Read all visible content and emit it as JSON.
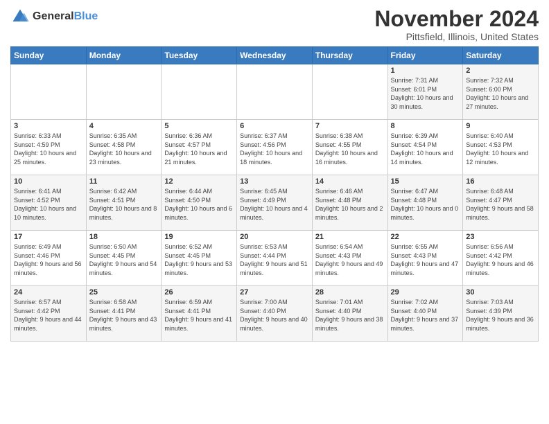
{
  "logo": {
    "general": "General",
    "blue": "Blue"
  },
  "title": "November 2024",
  "subtitle": "Pittsfield, Illinois, United States",
  "days_of_week": [
    "Sunday",
    "Monday",
    "Tuesday",
    "Wednesday",
    "Thursday",
    "Friday",
    "Saturday"
  ],
  "weeks": [
    [
      {
        "day": "",
        "info": ""
      },
      {
        "day": "",
        "info": ""
      },
      {
        "day": "",
        "info": ""
      },
      {
        "day": "",
        "info": ""
      },
      {
        "day": "",
        "info": ""
      },
      {
        "day": "1",
        "info": "Sunrise: 7:31 AM\nSunset: 6:01 PM\nDaylight: 10 hours and 30 minutes."
      },
      {
        "day": "2",
        "info": "Sunrise: 7:32 AM\nSunset: 6:00 PM\nDaylight: 10 hours and 27 minutes."
      }
    ],
    [
      {
        "day": "3",
        "info": "Sunrise: 6:33 AM\nSunset: 4:59 PM\nDaylight: 10 hours and 25 minutes."
      },
      {
        "day": "4",
        "info": "Sunrise: 6:35 AM\nSunset: 4:58 PM\nDaylight: 10 hours and 23 minutes."
      },
      {
        "day": "5",
        "info": "Sunrise: 6:36 AM\nSunset: 4:57 PM\nDaylight: 10 hours and 21 minutes."
      },
      {
        "day": "6",
        "info": "Sunrise: 6:37 AM\nSunset: 4:56 PM\nDaylight: 10 hours and 18 minutes."
      },
      {
        "day": "7",
        "info": "Sunrise: 6:38 AM\nSunset: 4:55 PM\nDaylight: 10 hours and 16 minutes."
      },
      {
        "day": "8",
        "info": "Sunrise: 6:39 AM\nSunset: 4:54 PM\nDaylight: 10 hours and 14 minutes."
      },
      {
        "day": "9",
        "info": "Sunrise: 6:40 AM\nSunset: 4:53 PM\nDaylight: 10 hours and 12 minutes."
      }
    ],
    [
      {
        "day": "10",
        "info": "Sunrise: 6:41 AM\nSunset: 4:52 PM\nDaylight: 10 hours and 10 minutes."
      },
      {
        "day": "11",
        "info": "Sunrise: 6:42 AM\nSunset: 4:51 PM\nDaylight: 10 hours and 8 minutes."
      },
      {
        "day": "12",
        "info": "Sunrise: 6:44 AM\nSunset: 4:50 PM\nDaylight: 10 hours and 6 minutes."
      },
      {
        "day": "13",
        "info": "Sunrise: 6:45 AM\nSunset: 4:49 PM\nDaylight: 10 hours and 4 minutes."
      },
      {
        "day": "14",
        "info": "Sunrise: 6:46 AM\nSunset: 4:48 PM\nDaylight: 10 hours and 2 minutes."
      },
      {
        "day": "15",
        "info": "Sunrise: 6:47 AM\nSunset: 4:48 PM\nDaylight: 10 hours and 0 minutes."
      },
      {
        "day": "16",
        "info": "Sunrise: 6:48 AM\nSunset: 4:47 PM\nDaylight: 9 hours and 58 minutes."
      }
    ],
    [
      {
        "day": "17",
        "info": "Sunrise: 6:49 AM\nSunset: 4:46 PM\nDaylight: 9 hours and 56 minutes."
      },
      {
        "day": "18",
        "info": "Sunrise: 6:50 AM\nSunset: 4:45 PM\nDaylight: 9 hours and 54 minutes."
      },
      {
        "day": "19",
        "info": "Sunrise: 6:52 AM\nSunset: 4:45 PM\nDaylight: 9 hours and 53 minutes."
      },
      {
        "day": "20",
        "info": "Sunrise: 6:53 AM\nSunset: 4:44 PM\nDaylight: 9 hours and 51 minutes."
      },
      {
        "day": "21",
        "info": "Sunrise: 6:54 AM\nSunset: 4:43 PM\nDaylight: 9 hours and 49 minutes."
      },
      {
        "day": "22",
        "info": "Sunrise: 6:55 AM\nSunset: 4:43 PM\nDaylight: 9 hours and 47 minutes."
      },
      {
        "day": "23",
        "info": "Sunrise: 6:56 AM\nSunset: 4:42 PM\nDaylight: 9 hours and 46 minutes."
      }
    ],
    [
      {
        "day": "24",
        "info": "Sunrise: 6:57 AM\nSunset: 4:42 PM\nDaylight: 9 hours and 44 minutes."
      },
      {
        "day": "25",
        "info": "Sunrise: 6:58 AM\nSunset: 4:41 PM\nDaylight: 9 hours and 43 minutes."
      },
      {
        "day": "26",
        "info": "Sunrise: 6:59 AM\nSunset: 4:41 PM\nDaylight: 9 hours and 41 minutes."
      },
      {
        "day": "27",
        "info": "Sunrise: 7:00 AM\nSunset: 4:40 PM\nDaylight: 9 hours and 40 minutes."
      },
      {
        "day": "28",
        "info": "Sunrise: 7:01 AM\nSunset: 4:40 PM\nDaylight: 9 hours and 38 minutes."
      },
      {
        "day": "29",
        "info": "Sunrise: 7:02 AM\nSunset: 4:40 PM\nDaylight: 9 hours and 37 minutes."
      },
      {
        "day": "30",
        "info": "Sunrise: 7:03 AM\nSunset: 4:39 PM\nDaylight: 9 hours and 36 minutes."
      }
    ]
  ]
}
